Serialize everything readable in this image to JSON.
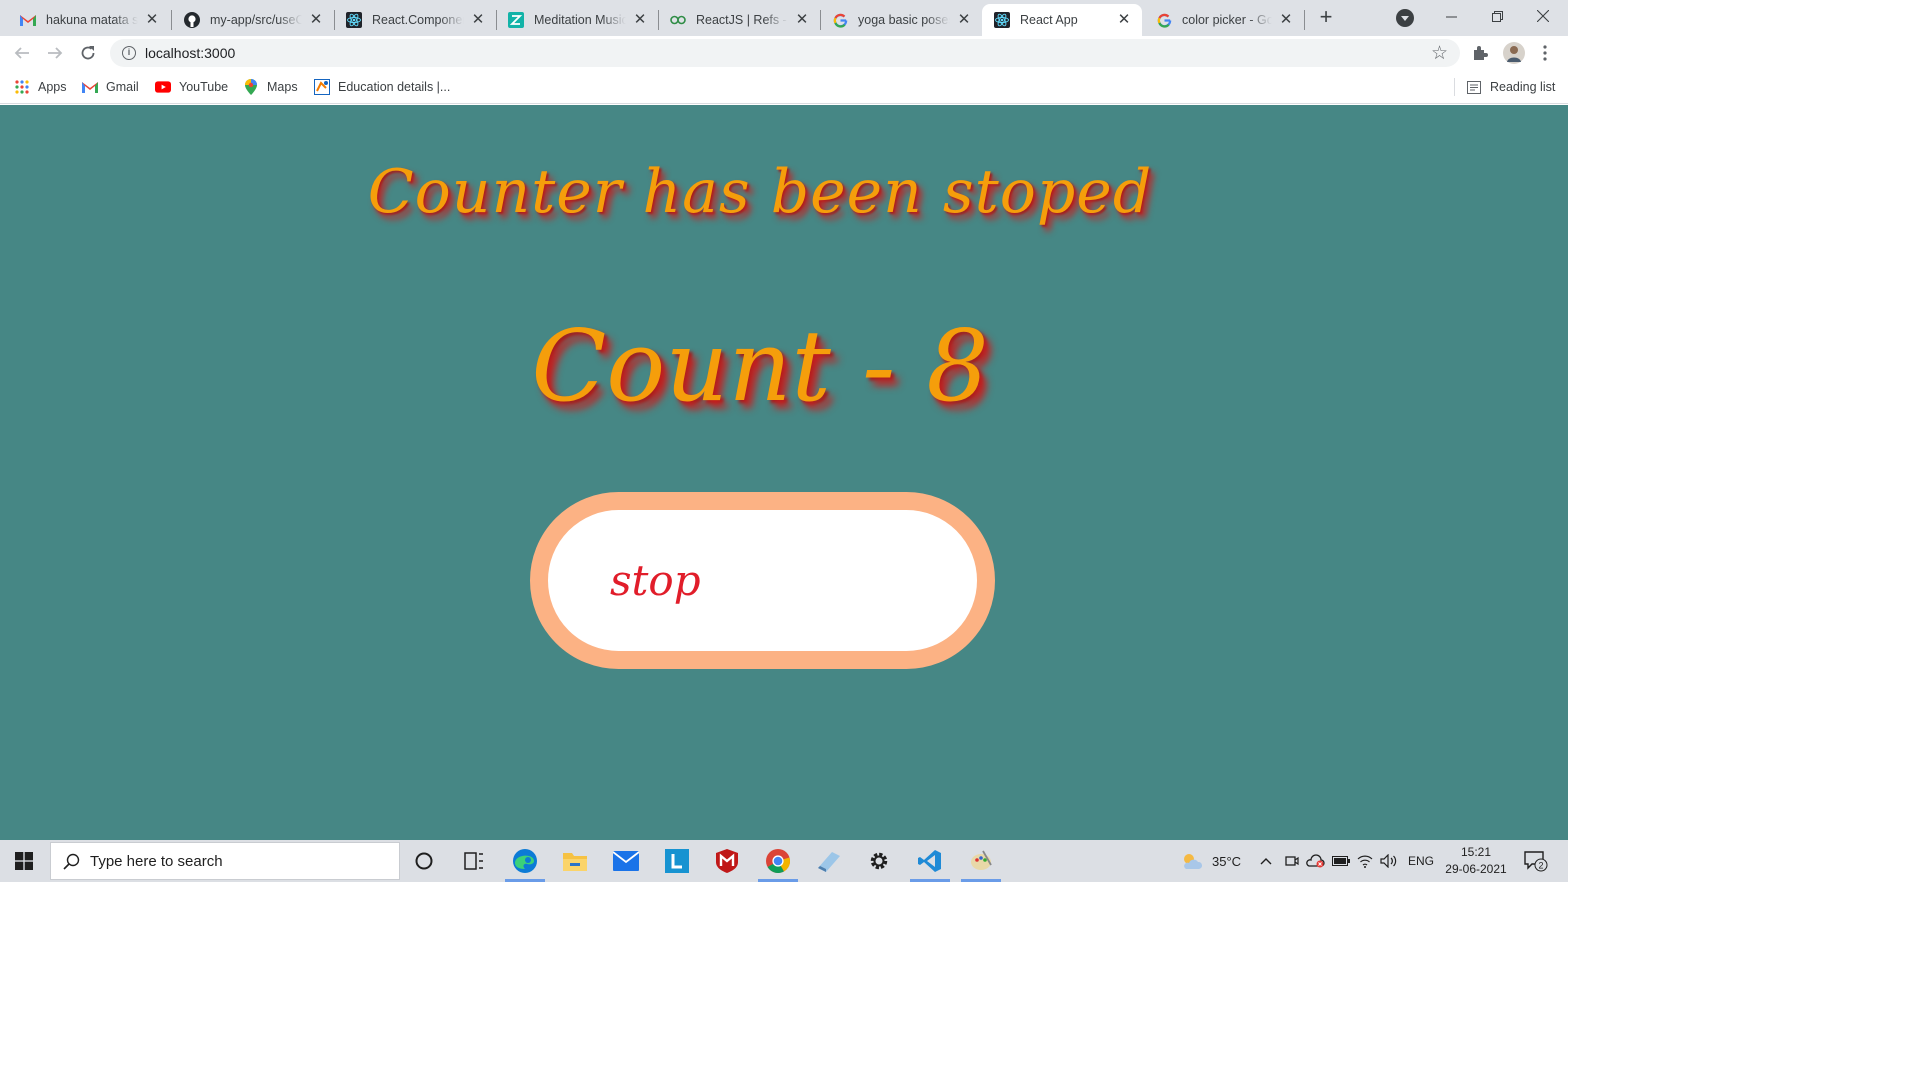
{
  "browser": {
    "tabs": [
      {
        "title": "hakuna matata song",
        "icon": "gmail-icon",
        "active": false
      },
      {
        "title": "my-app/src/useCounter",
        "icon": "github-icon",
        "active": false
      },
      {
        "title": "React.Component",
        "icon": "react-icon",
        "active": false
      },
      {
        "title": "Meditation Music",
        "icon": "z-app-icon",
        "active": false
      },
      {
        "title": "ReactJS | Refs - GeeksforGeeks",
        "icon": "geeksforgeeks-icon",
        "active": false
      },
      {
        "title": "yoga basic poses",
        "icon": "google-icon",
        "active": false
      },
      {
        "title": "React App",
        "icon": "react-icon",
        "active": true
      },
      {
        "title": "color picker - Google Search",
        "icon": "google-icon",
        "active": false
      }
    ],
    "address": "localhost:3000",
    "bookmarks": [
      {
        "label": "Apps",
        "icon": "apps-grid-icon"
      },
      {
        "label": "Gmail",
        "icon": "gmail-icon"
      },
      {
        "label": "YouTube",
        "icon": "youtube-icon"
      },
      {
        "label": "Maps",
        "icon": "maps-icon"
      },
      {
        "label": "Education details |...",
        "icon": "education-icon"
      }
    ],
    "reading_list": "Reading list"
  },
  "page": {
    "status_message": "Counter has been stoped",
    "count_text": "Count - 8",
    "stop_button": "stop",
    "colors": {
      "background": "#468785",
      "heading": "#f59e0b",
      "shadow": "#c81e1e",
      "button_border": "#fcb284",
      "button_text": "#e11d2a"
    }
  },
  "taskbar": {
    "search_placeholder": "Type here to search",
    "weather": "35°C",
    "language": "ENG",
    "time": "15:21",
    "date": "29-06-2021",
    "notification_count": "2"
  }
}
